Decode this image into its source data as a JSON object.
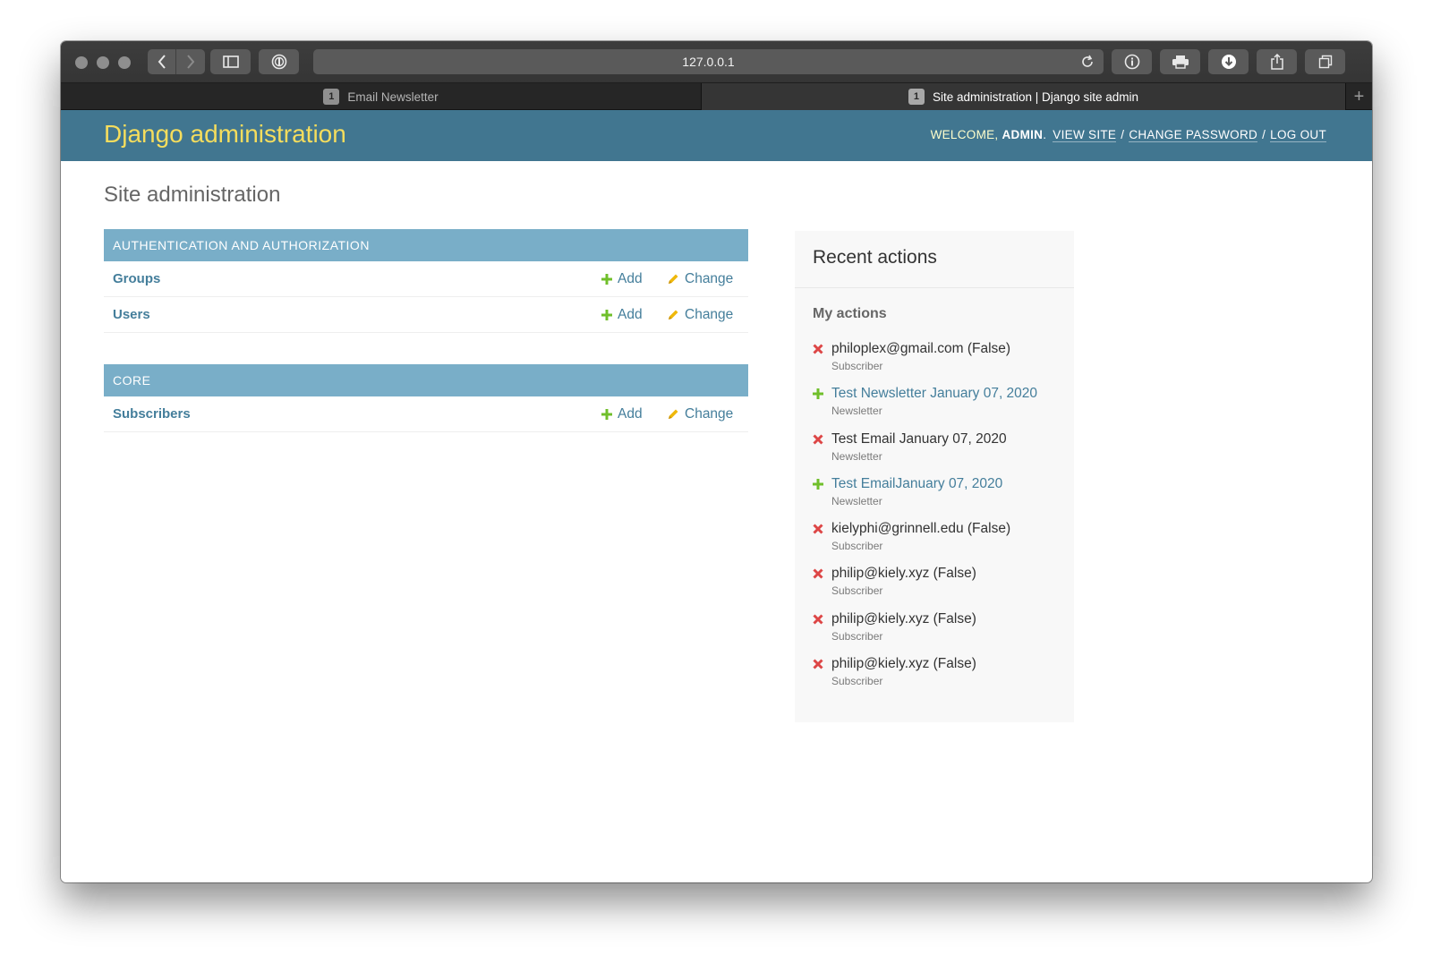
{
  "browser": {
    "url": "127.0.0.1",
    "tabs": [
      {
        "number": "1",
        "title": "Email Newsletter",
        "active": false
      },
      {
        "number": "1",
        "title": "Site administration | Django site admin",
        "active": true
      }
    ],
    "new_tab": "+"
  },
  "header": {
    "branding": "Django administration",
    "welcome": "WELCOME,",
    "username": "ADMIN",
    "view_site": "VIEW SITE",
    "change_password": "CHANGE PASSWORD",
    "log_out": "LOG OUT",
    "separator": "/",
    "period": "."
  },
  "page": {
    "title": "Site administration"
  },
  "modules": [
    {
      "caption": "AUTHENTICATION AND AUTHORIZATION",
      "models": [
        {
          "name": "Groups",
          "add": "Add",
          "change": "Change"
        },
        {
          "name": "Users",
          "add": "Add",
          "change": "Change"
        }
      ]
    },
    {
      "caption": "CORE",
      "models": [
        {
          "name": "Subscribers",
          "add": "Add",
          "change": "Change"
        }
      ]
    }
  ],
  "recent_actions": {
    "title": "Recent actions",
    "subtitle": "My actions",
    "items": [
      {
        "kind": "delete",
        "title": "philoplex@gmail.com (False)",
        "type": "Subscriber"
      },
      {
        "kind": "add",
        "title": "Test Newsletter January 07, 2020",
        "type": "Newsletter"
      },
      {
        "kind": "delete",
        "title": "Test Email January 07, 2020",
        "type": "Newsletter"
      },
      {
        "kind": "add",
        "title": "Test EmailJanuary 07, 2020",
        "type": "Newsletter"
      },
      {
        "kind": "delete",
        "title": "kielyphi@grinnell.edu (False)",
        "type": "Subscriber"
      },
      {
        "kind": "delete",
        "title": "philip@kiely.xyz (False)",
        "type": "Subscriber"
      },
      {
        "kind": "delete",
        "title": "philip@kiely.xyz (False)",
        "type": "Subscriber"
      },
      {
        "kind": "delete",
        "title": "philip@kiely.xyz (False)",
        "type": "Subscriber"
      }
    ]
  },
  "colors": {
    "header_bg": "#417690",
    "branding": "#f5dd5d",
    "caption_bg": "#79aec8",
    "link": "#447e9b",
    "add_icon": "#70bf2b",
    "change_icon": "#efb80b",
    "delete_icon": "#dd4646"
  },
  "icons": {
    "add": "plus-icon",
    "change": "pencil-icon",
    "delete": "x-icon"
  }
}
